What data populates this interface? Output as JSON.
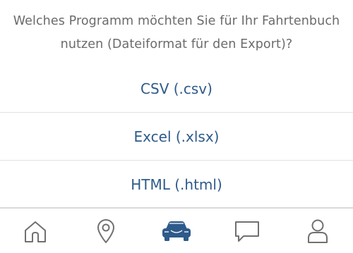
{
  "question": {
    "line1": "Welches Programm möchten Sie für Ihr Fahrtenbuch",
    "line2": "nutzen (Dateiformat für den Export)?"
  },
  "options": [
    {
      "label": "CSV (.csv)"
    },
    {
      "label": "Excel (.xlsx)"
    },
    {
      "label": "HTML (.html)"
    }
  ],
  "tabbar": {
    "tabs": [
      {
        "icon": "home-icon",
        "active": false
      },
      {
        "icon": "location-pin-icon",
        "active": false
      },
      {
        "icon": "car-icon",
        "active": true
      },
      {
        "icon": "chat-icon",
        "active": false
      },
      {
        "icon": "user-icon",
        "active": false
      }
    ]
  },
  "colors": {
    "accent": "#2e5a8a",
    "question_text": "#6b6b6b",
    "icon_inactive": "#707070",
    "divider": "#e2e2e2"
  }
}
